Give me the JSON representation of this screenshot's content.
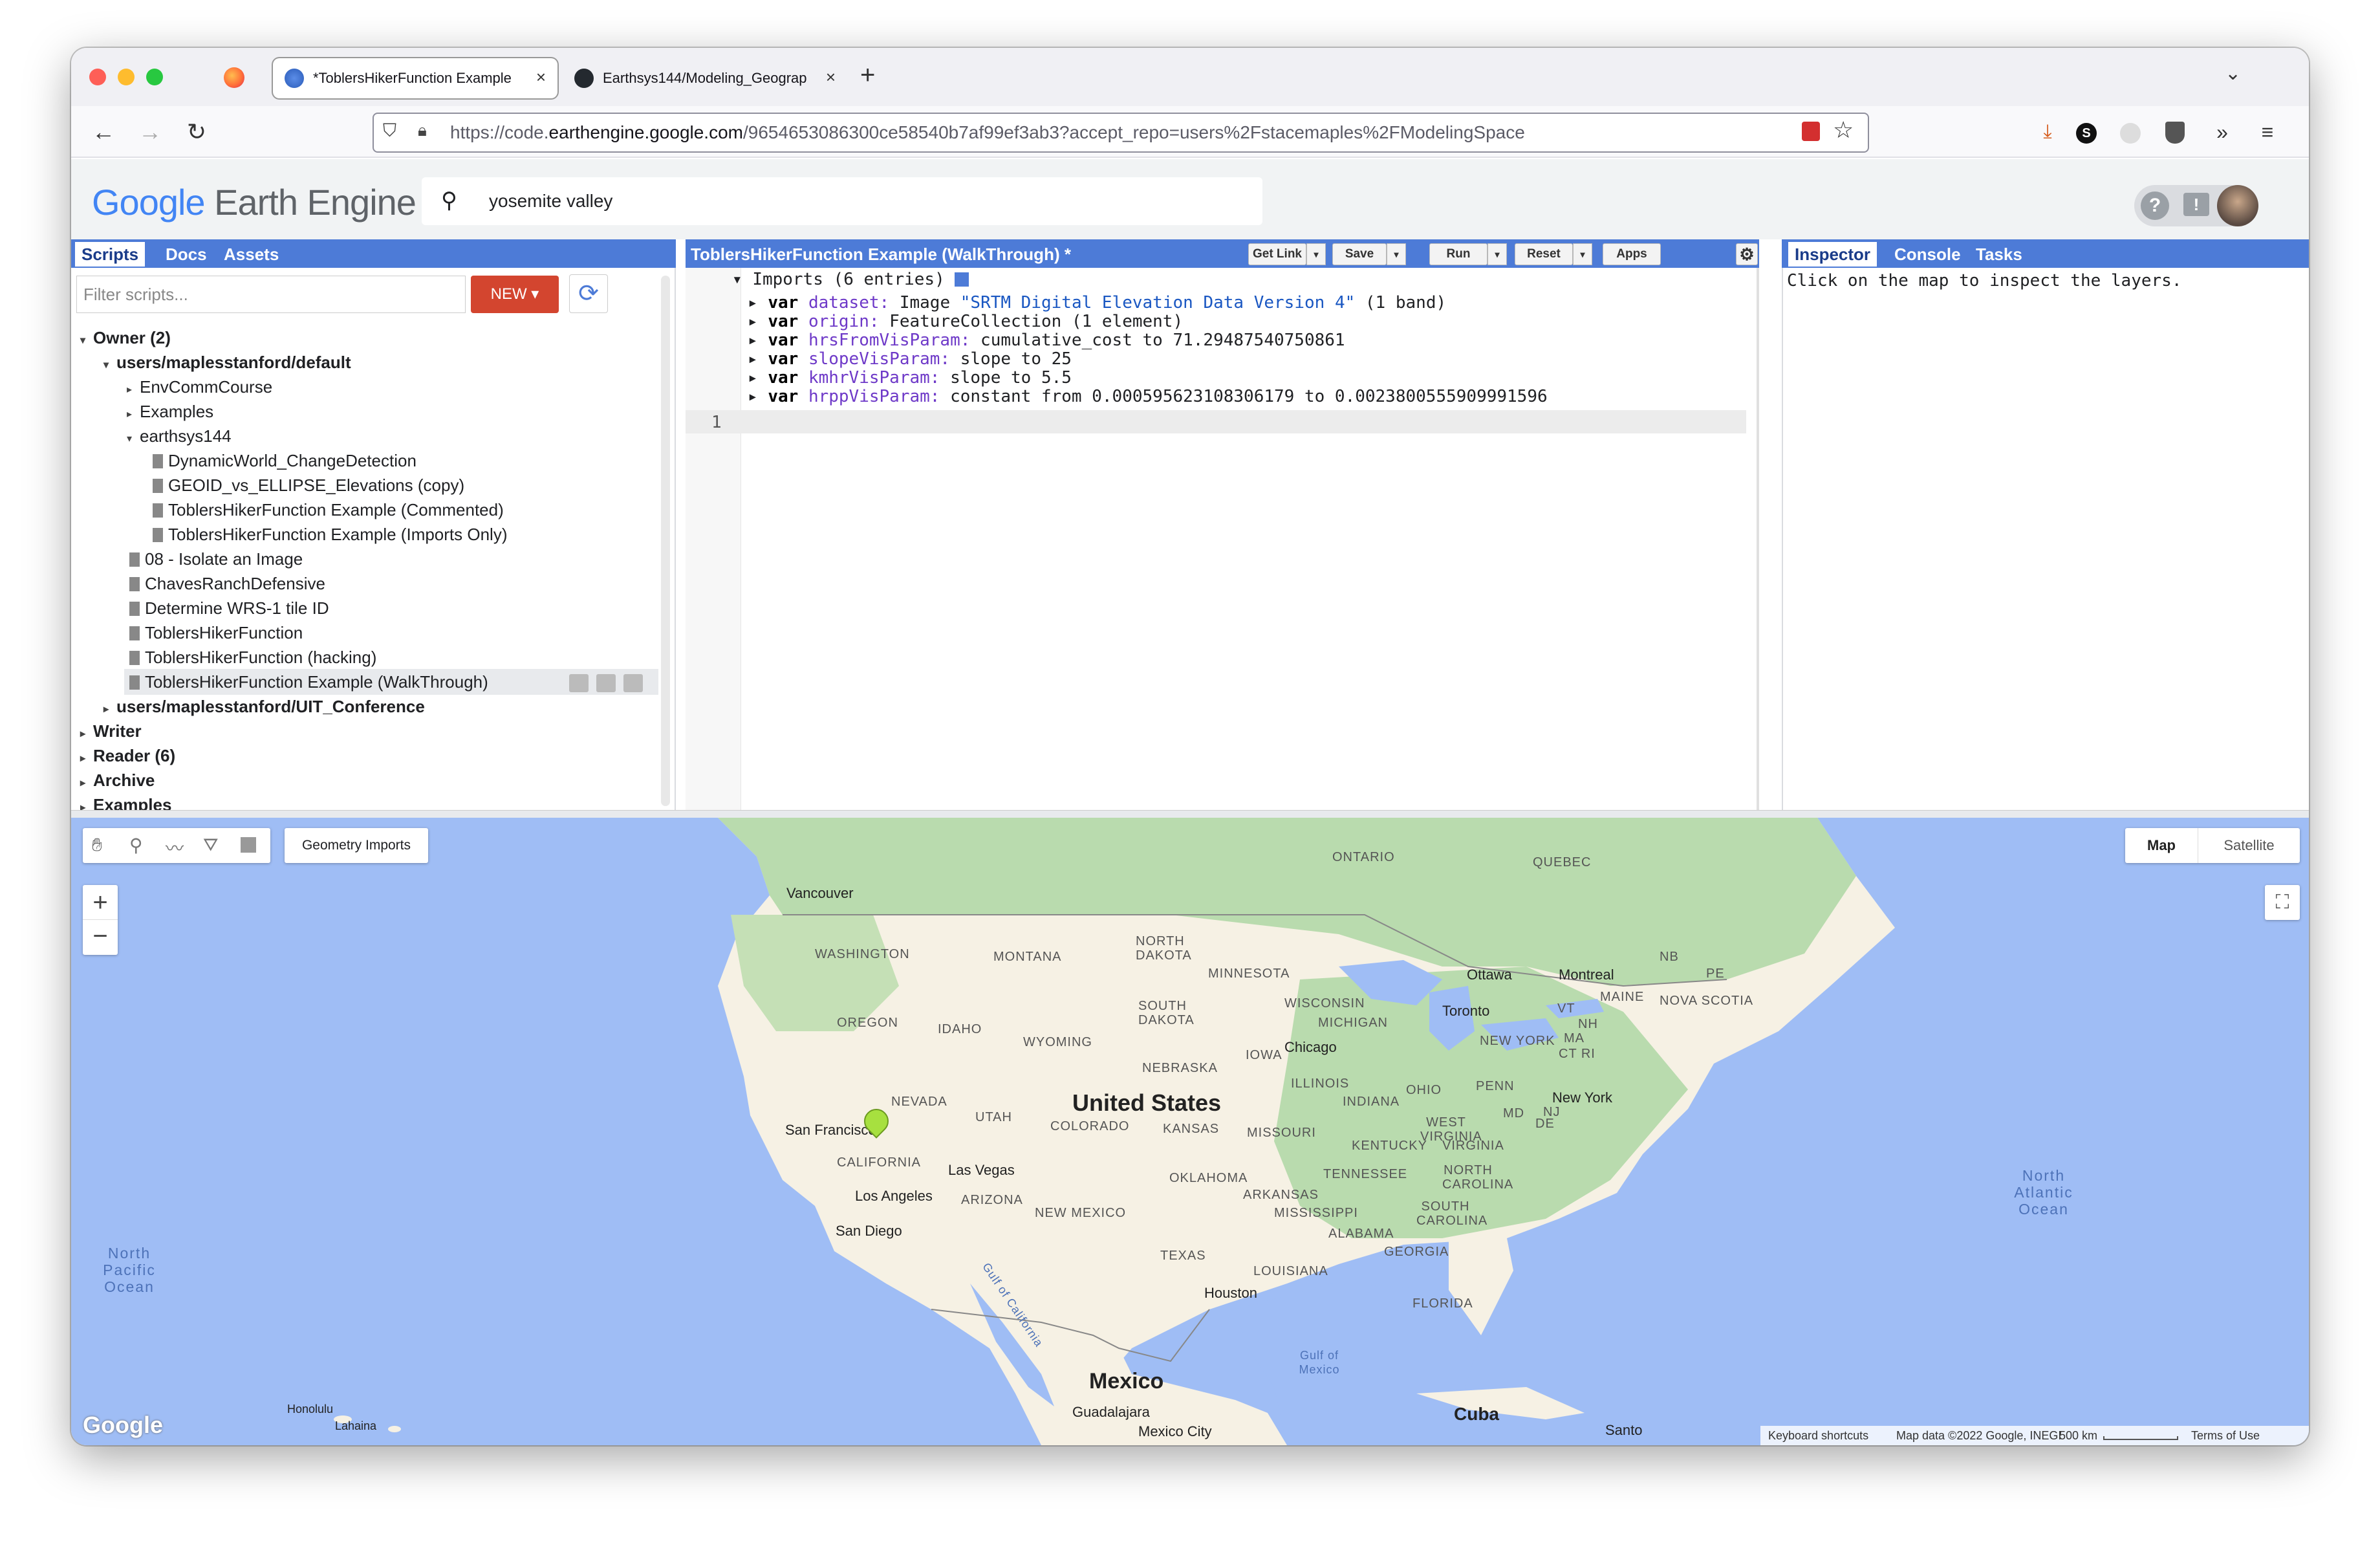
{
  "browser": {
    "tabs": [
      {
        "title": "*ToblersHikerFunction Example"
      },
      {
        "title": "Earthsys144/Modeling_Geograp"
      }
    ],
    "url_prefix": "https://code.",
    "url_domain": "earthengine.google.com",
    "url_rest": "/9654653086300ce58540b7af99ef3ab3?accept_repo=users%2Fstacemaples%2FModelingSpace"
  },
  "header": {
    "logo_google": "Google",
    "logo_product": "Earth Engine",
    "search_value": "yosemite valley"
  },
  "left_panel": {
    "tabs": [
      "Scripts",
      "Docs",
      "Assets"
    ],
    "filter_placeholder": "Filter scripts...",
    "new_button": "NEW",
    "tree": {
      "owner": "Owner (2)",
      "repo_default": "users/maplesstanford/default",
      "folders": [
        "EnvCommCourse",
        "Examples",
        "earthsys144"
      ],
      "earthsys144_files": [
        "DynamicWorld_ChangeDetection",
        "GEOID_vs_ELLIPSE_Elevations (copy)",
        "ToblersHikerFunction Example (Commented)",
        "ToblersHikerFunction Example (Imports Only)"
      ],
      "files": [
        "08 - Isolate an Image",
        "ChavesRanchDefensive",
        "Determine WRS-1 tile ID",
        "ToblersHikerFunction",
        "ToblersHikerFunction (hacking)",
        "ToblersHikerFunction Example (WalkThrough)"
      ],
      "repo_uit": "users/maplesstanford/UIT_Conference",
      "groups": [
        "Writer",
        "Reader (6)",
        "Archive",
        "Examples"
      ]
    }
  },
  "editor": {
    "title": "ToblersHikerFunction Example (WalkThrough) *",
    "buttons": {
      "get_link": "Get Link",
      "save": "Save",
      "run": "Run",
      "reset": "Reset",
      "apps": "Apps"
    },
    "imports_header": "Imports (6 entries)",
    "imports": [
      {
        "kw": "var",
        "name": "dataset:",
        "pre": "Image",
        "str": "\"SRTM Digital Elevation Data Version 4\"",
        "post": "(1 band)"
      },
      {
        "kw": "var",
        "name": "origin:",
        "pre": "FeatureCollection (1 element)",
        "str": "",
        "post": ""
      },
      {
        "kw": "var",
        "name": "hrsFromVisParam:",
        "pre": "cumulative_cost to 71.29487540750861",
        "str": "",
        "post": ""
      },
      {
        "kw": "var",
        "name": "slopeVisParam:",
        "pre": "slope to 25",
        "str": "",
        "post": ""
      },
      {
        "kw": "var",
        "name": "kmhrVisParam:",
        "pre": "slope to 5.5",
        "str": "",
        "post": ""
      },
      {
        "kw": "var",
        "name": "hrppVisParam:",
        "pre": "constant from 0.000595623108306179 to 0.0023800555909991596",
        "str": "",
        "post": ""
      }
    ],
    "line_number": "1"
  },
  "right_panel": {
    "tabs": [
      "Inspector",
      "Console",
      "Tasks"
    ],
    "message": "Click on the map to inspect the layers."
  },
  "map": {
    "geometry_imports": "Geometry Imports",
    "map_type_buttons": [
      "Map",
      "Satellite"
    ],
    "zoom_in": "+",
    "zoom_out": "−",
    "country_label": "United States",
    "mexico_label": "Mexico",
    "cuba_label": "Cuba",
    "region_labels": [
      "ONTARIO",
      "QUEBEC",
      "WASHINGTON",
      "MONTANA",
      "NORTH DAKOTA",
      "MINNESOTA",
      "OREGON",
      "IDAHO",
      "SOUTH DAKOTA",
      "WISCONSIN",
      "MICHIGAN",
      "WYOMING",
      "NEBRASKA",
      "IOWA",
      "ILLINOIS",
      "INDIANA",
      "OHIO",
      "PENN",
      "NEVADA",
      "UTAH",
      "COLORADO",
      "KANSAS",
      "MISSOURI",
      "KENTUCKY",
      "WEST VIRGINIA",
      "VIRGINIA",
      "CALIFORNIA",
      "ARIZONA",
      "NEW MEXICO",
      "OKLAHOMA",
      "ARKANSAS",
      "TENNESSEE",
      "NORTH CAROLINA",
      "SOUTH CAROLINA",
      "MISSISSIPPI",
      "ALABAMA",
      "GEORGIA",
      "TEXAS",
      "LOUISIANA",
      "FLORIDA",
      "NEW YORK",
      "NB",
      "PE",
      "MAINE",
      "NOVA SCOTIA",
      "VT",
      "NH",
      "MA",
      "CT RI",
      "MD",
      "DE",
      "NJ"
    ],
    "cities": [
      "Vancouver",
      "Ottawa",
      "Montreal",
      "Toronto",
      "Chicago",
      "New York",
      "San Francisco",
      "Las Vegas",
      "Los Angeles",
      "San Diego",
      "Houston",
      "Guadalajara",
      "Mexico City",
      "Honolulu",
      "Lahaina",
      "Santo"
    ],
    "oceans": {
      "pacific": "North Pacific Ocean",
      "atlantic": "North Atlantic Ocean",
      "gulf_ca": "Gulf of California",
      "gulf_mx": "Gulf of Mexico"
    },
    "footer": {
      "google": "Google",
      "shortcuts": "Keyboard shortcuts",
      "map_data": "Map data ©2022 Google, INEGI",
      "scale": "500 km",
      "terms": "Terms of Use"
    }
  },
  "colors": {
    "accent": "#4d7bd7",
    "new_button": "#d3452f",
    "land": "#f6f1e4",
    "water": "#9fbdf5",
    "forest": "#b9dbae",
    "marker": "#a7e03f"
  }
}
